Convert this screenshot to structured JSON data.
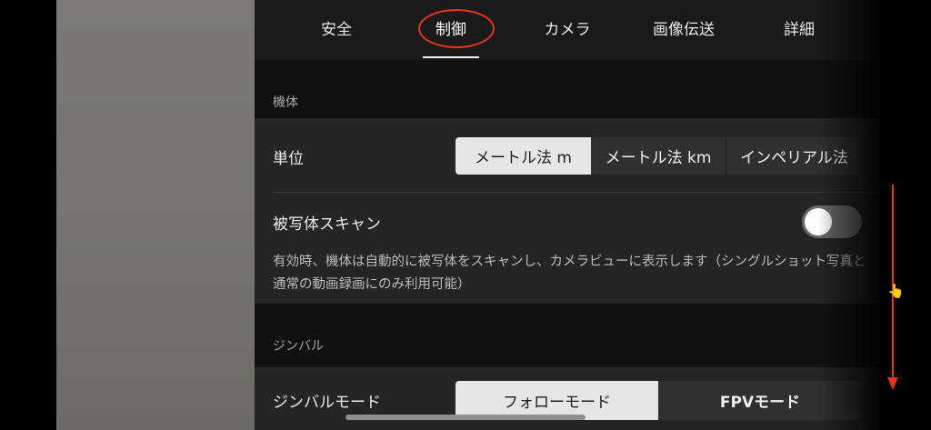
{
  "tabs": [
    {
      "label": "安全"
    },
    {
      "label": "制御"
    },
    {
      "label": "カメラ"
    },
    {
      "label": "画像伝送"
    },
    {
      "label": "詳細"
    }
  ],
  "active_tab": "制御",
  "sections": {
    "aircraft": {
      "header": "機体",
      "units": {
        "label": "単位",
        "options": [
          "メートル法 m",
          "メートル法 km",
          "インペリアル法"
        ],
        "selected": "メートル法 m"
      },
      "subject_scan": {
        "label": "被写体スキャン",
        "enabled": false,
        "description": "有効時、機体は自動的に被写体をスキャンし、カメラビューに表示します（シングルショット写真と通常の動画録画にのみ利用可能）"
      }
    },
    "gimbal": {
      "header": "ジンバル",
      "mode": {
        "label": "ジンバルモード",
        "options": [
          "フォローモード",
          "FPVモード"
        ],
        "selected": "フォローモード"
      }
    }
  },
  "colors": {
    "annotation_red": "#e8321c",
    "selected_segment": "#e6e6e6"
  },
  "icons": {
    "scroll_hint": "pointing-hand-icon",
    "arrow": "down-arrow-icon"
  }
}
